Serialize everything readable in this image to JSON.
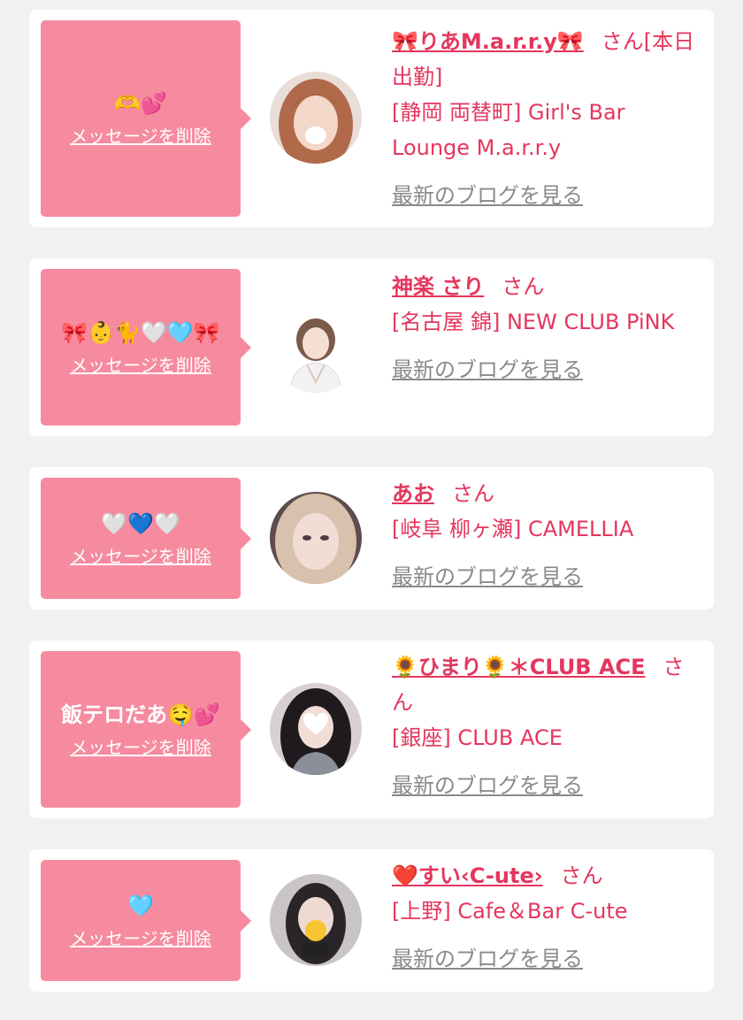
{
  "delete_label": "メッセージを削除",
  "blog_label": "最新のブログを見る",
  "honorific": "さん",
  "colors": {
    "page_background": "#f1f1f1",
    "bubble": "#f68b9f",
    "name_text": "#e5365d",
    "blog_link": "#8a8a8a"
  },
  "messages": [
    {
      "message": "🫶💕",
      "name": "🎀りあM.a.r.r.y🎀",
      "status": "[本日出勤]",
      "shop": "[静岡 両替町] Girl's Bar Lounge M.a.r.r.y"
    },
    {
      "message": "🎀👶🐈🤍🩵🎀",
      "name": "神楽 さり",
      "status": "",
      "shop": "[名古屋 錦] NEW CLUB PiNK"
    },
    {
      "message": "🤍💙🤍",
      "name": "あお",
      "status": "",
      "shop": "[岐阜 柳ヶ瀬] CAMELLIA"
    },
    {
      "message": "飯テロだあ🤤💕",
      "name": "🌻ひまり🌻＊CLUB ACE",
      "status": "",
      "shop": "[銀座] CLUB ACE"
    },
    {
      "message": "🩵",
      "name": "❤️すい‹C-ute›",
      "status": "",
      "shop": "[上野] Cafe＆Bar C-ute"
    }
  ]
}
